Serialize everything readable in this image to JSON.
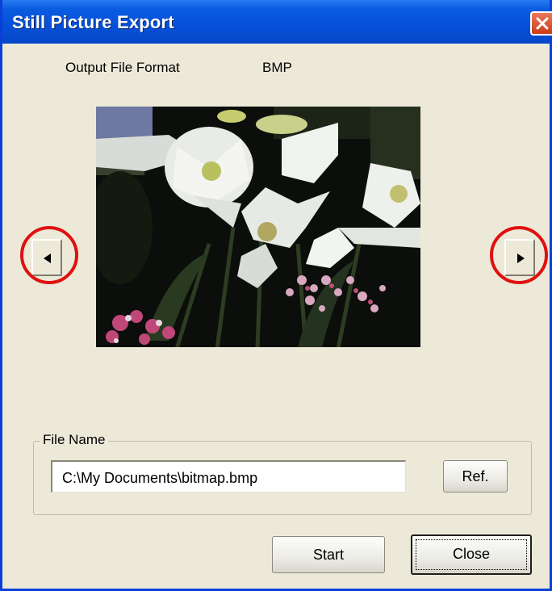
{
  "window": {
    "title": "Still Picture Export",
    "close_icon": "close-icon"
  },
  "output": {
    "label": "Output File Format",
    "value": "BMP"
  },
  "preview": {
    "prev_icon": "triangle-left-icon",
    "next_icon": "triangle-right-icon",
    "highlight_color": "#e01010"
  },
  "file": {
    "group_label": "File Name",
    "path": "C:\\My Documents\\bitmap.bmp",
    "ref_label": "Ref."
  },
  "actions": {
    "start_label": "Start",
    "close_label": "Close"
  }
}
